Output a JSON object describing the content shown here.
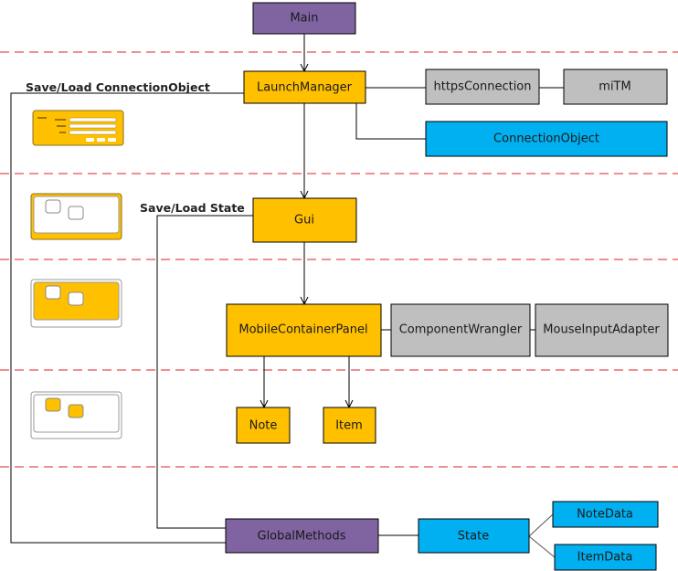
{
  "colors": {
    "purple": "#8064a2",
    "orange": "#ffc000",
    "gray": "#bfbfbf",
    "blue": "#00b0f0",
    "divider": "#e02020"
  },
  "nodes": {
    "main": "Main",
    "launch_manager": "LaunchManager",
    "https_connection": "httpsConnection",
    "mitm": "miTM",
    "connection_object": "ConnectionObject",
    "gui": "Gui",
    "mobile_container_panel": "MobileContainerPanel",
    "component_wrangler": "ComponentWrangler",
    "mouse_input_adapter": "MouseInputAdapter",
    "note": "Note",
    "item": "Item",
    "global_methods": "GlobalMethods",
    "state": "State",
    "note_data": "NoteData",
    "item_data": "ItemData"
  },
  "labels": {
    "save_load_connection": "Save/Load ConnectionObject",
    "save_load_state": "Save/Load State"
  },
  "icons": [
    "connection-form-icon",
    "window-frame-icon",
    "panel-icon",
    "components-icon"
  ]
}
